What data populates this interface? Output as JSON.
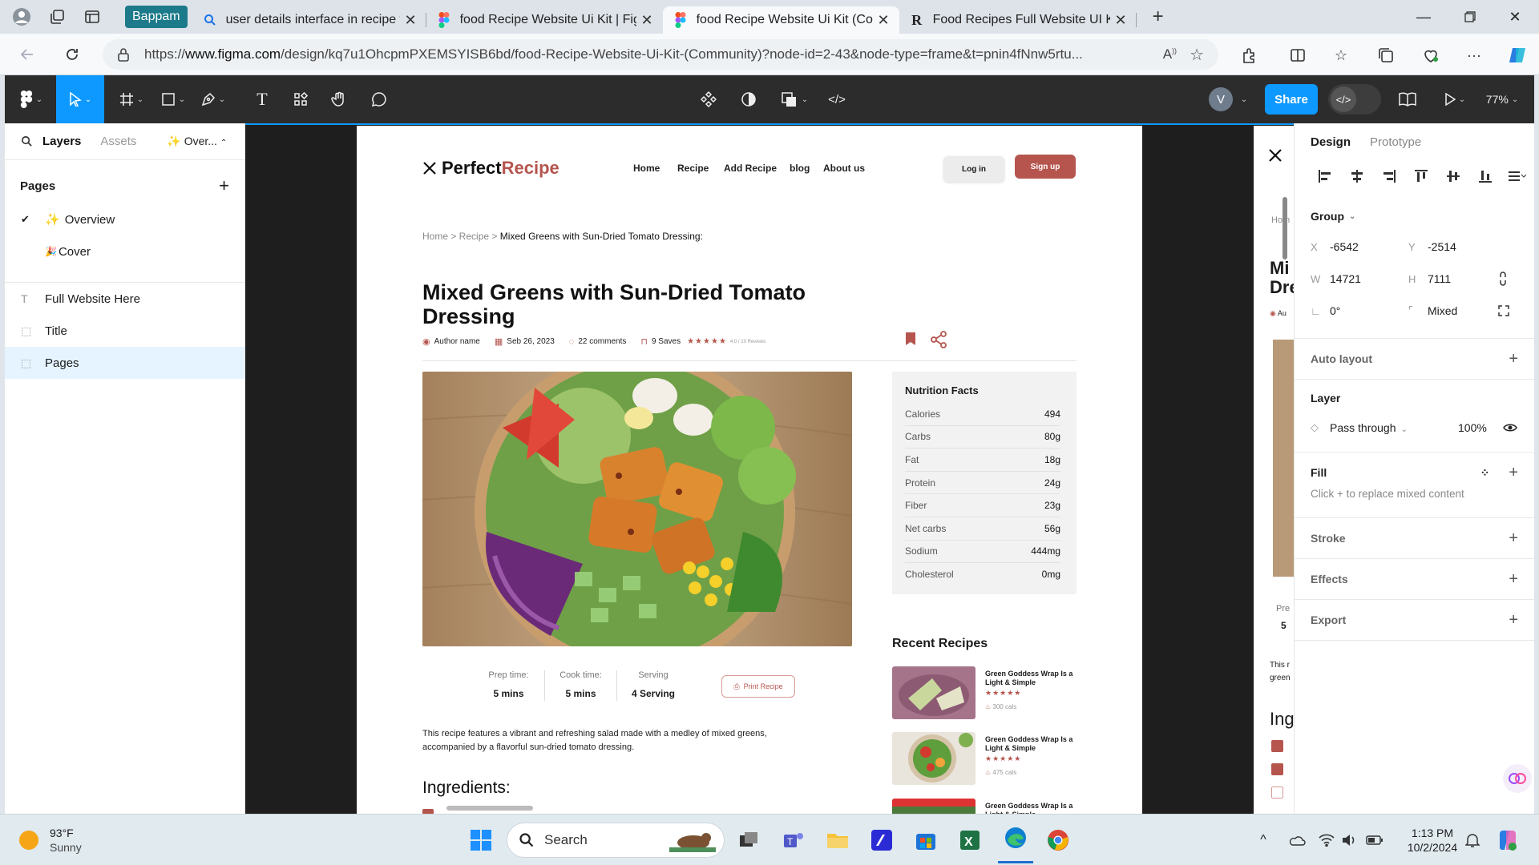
{
  "browser": {
    "group_label": "Bappam",
    "tabs": [
      {
        "title": "user details interface in recipe web",
        "icon": "search-icon",
        "active": false
      },
      {
        "title": "food Recipe Website Ui Kit | Figma",
        "icon": "figma-icon",
        "active": false
      },
      {
        "title": "food Recipe Website Ui Kit (Comm",
        "icon": "figma-icon",
        "active": true
      },
      {
        "title": "Food Recipes Full Website UI Kit F",
        "icon": "r-icon",
        "active": false
      }
    ],
    "url_prefix": "https://",
    "url_host": "www.figma.com",
    "url_path": "/design/kq7u1OhcpmPXEMSYISB6bd/food-Recipe-Website-Ui-Kit-(Community)?node-id=2-43&node-type=frame&t=pnin4fNnw5rtu..."
  },
  "figma": {
    "share_label": "Share",
    "zoom": "77%",
    "avatar_letter": "V",
    "left_panel": {
      "tabs": [
        "Layers",
        "Assets"
      ],
      "page_dropdown": "✨ Over...",
      "pages_heading": "Pages",
      "pages": [
        {
          "name": "Overview",
          "emoji": "✨",
          "current": true
        },
        {
          "name": "Cover",
          "emoji": "🎉",
          "current": false
        }
      ],
      "layers": [
        {
          "name": "Full Website Here",
          "type": "text",
          "selected": false
        },
        {
          "name": "Title",
          "type": "frame",
          "selected": false
        },
        {
          "name": "Pages",
          "type": "frame",
          "selected": true
        }
      ]
    },
    "right_panel": {
      "tabs": [
        "Design",
        "Prototype"
      ],
      "group_label": "Group",
      "x_label": "X",
      "x": "-6542",
      "y_label": "Y",
      "y": "-2514",
      "w_label": "W",
      "w": "14721",
      "h_label": "H",
      "h": "7111",
      "rotation": "0°",
      "radius": "Mixed",
      "auto_layout": "Auto layout",
      "layer_heading": "Layer",
      "blend": "Pass through",
      "opacity": "100%",
      "fill_heading": "Fill",
      "fill_hint": "Click + to replace mixed content",
      "stroke": "Stroke",
      "effects": "Effects",
      "export": "Export"
    }
  },
  "recipe_page": {
    "logo_a": "Perfect",
    "logo_b": "Recipe",
    "nav": [
      "Home",
      "Recipe",
      "Add Recipe",
      "blog",
      "About us"
    ],
    "login": "Log in",
    "signup": "Sign up",
    "breadcrumb_a": "Home > Recipe > ",
    "breadcrumb_b": "Mixed Greens with Sun-Dried Tomato Dressing:",
    "title": "Mixed Greens with Sun-Dried Tomato Dressing",
    "author": "Author name",
    "date": "Seb 26, 2023",
    "comments": "22 comments",
    "saves": "9 Saves",
    "stars": "★★★★★",
    "rating_note": "4.0 / 10 Reviews",
    "nutrition": {
      "heading": "Nutrition Facts",
      "rows": [
        {
          "k": "Calories",
          "v": "494"
        },
        {
          "k": "Carbs",
          "v": "80g"
        },
        {
          "k": "Fat",
          "v": "18g"
        },
        {
          "k": "Protein",
          "v": "24g"
        },
        {
          "k": "Fiber",
          "v": "23g"
        },
        {
          "k": "Net carbs",
          "v": "56g"
        },
        {
          "k": "Sodium",
          "v": "444mg"
        },
        {
          "k": "Cholesterol",
          "v": "0mg"
        }
      ]
    },
    "recent_heading": "Recent Recipes",
    "recent": [
      {
        "title": "Green Goddess Wrap Is a Light & Simple",
        "stars": "★★★★★",
        "cals": "300 cals"
      },
      {
        "title": "Green Goddess Wrap Is a Light & Simple",
        "stars": "★★★★★",
        "cals": "475 cals"
      },
      {
        "title": "Green Goddess Wrap Is a Light & Simple",
        "stars": "",
        "cals": ""
      }
    ],
    "prep_label": "Prep time:",
    "prep": "5 mins",
    "cook_label": "Cook time:",
    "cook": "5 mins",
    "serving_label": "Serving",
    "serving": "4 Serving",
    "print": "Print Recipe",
    "description": "This recipe features a vibrant and refreshing salad made with a medley of mixed greens, accompanied by a flavorful sun-dried tomato dressing.",
    "ingredients_heading": "Ingredients:"
  },
  "mirror_frame": {
    "crumb": "Hom",
    "title_a": "Mi",
    "title_b": "Dre",
    "author": "Au",
    "pre": "Pre",
    "num": "5",
    "desc_a": "This r",
    "desc_b": "green",
    "ing": "Ing"
  },
  "taskbar": {
    "temp": "93°F",
    "weather": "Sunny",
    "search": "Search",
    "time": "1:13 PM",
    "date": "10/2/2024"
  },
  "colors": {
    "accent": "#b5554e",
    "figma_blue": "#0d99ff"
  }
}
